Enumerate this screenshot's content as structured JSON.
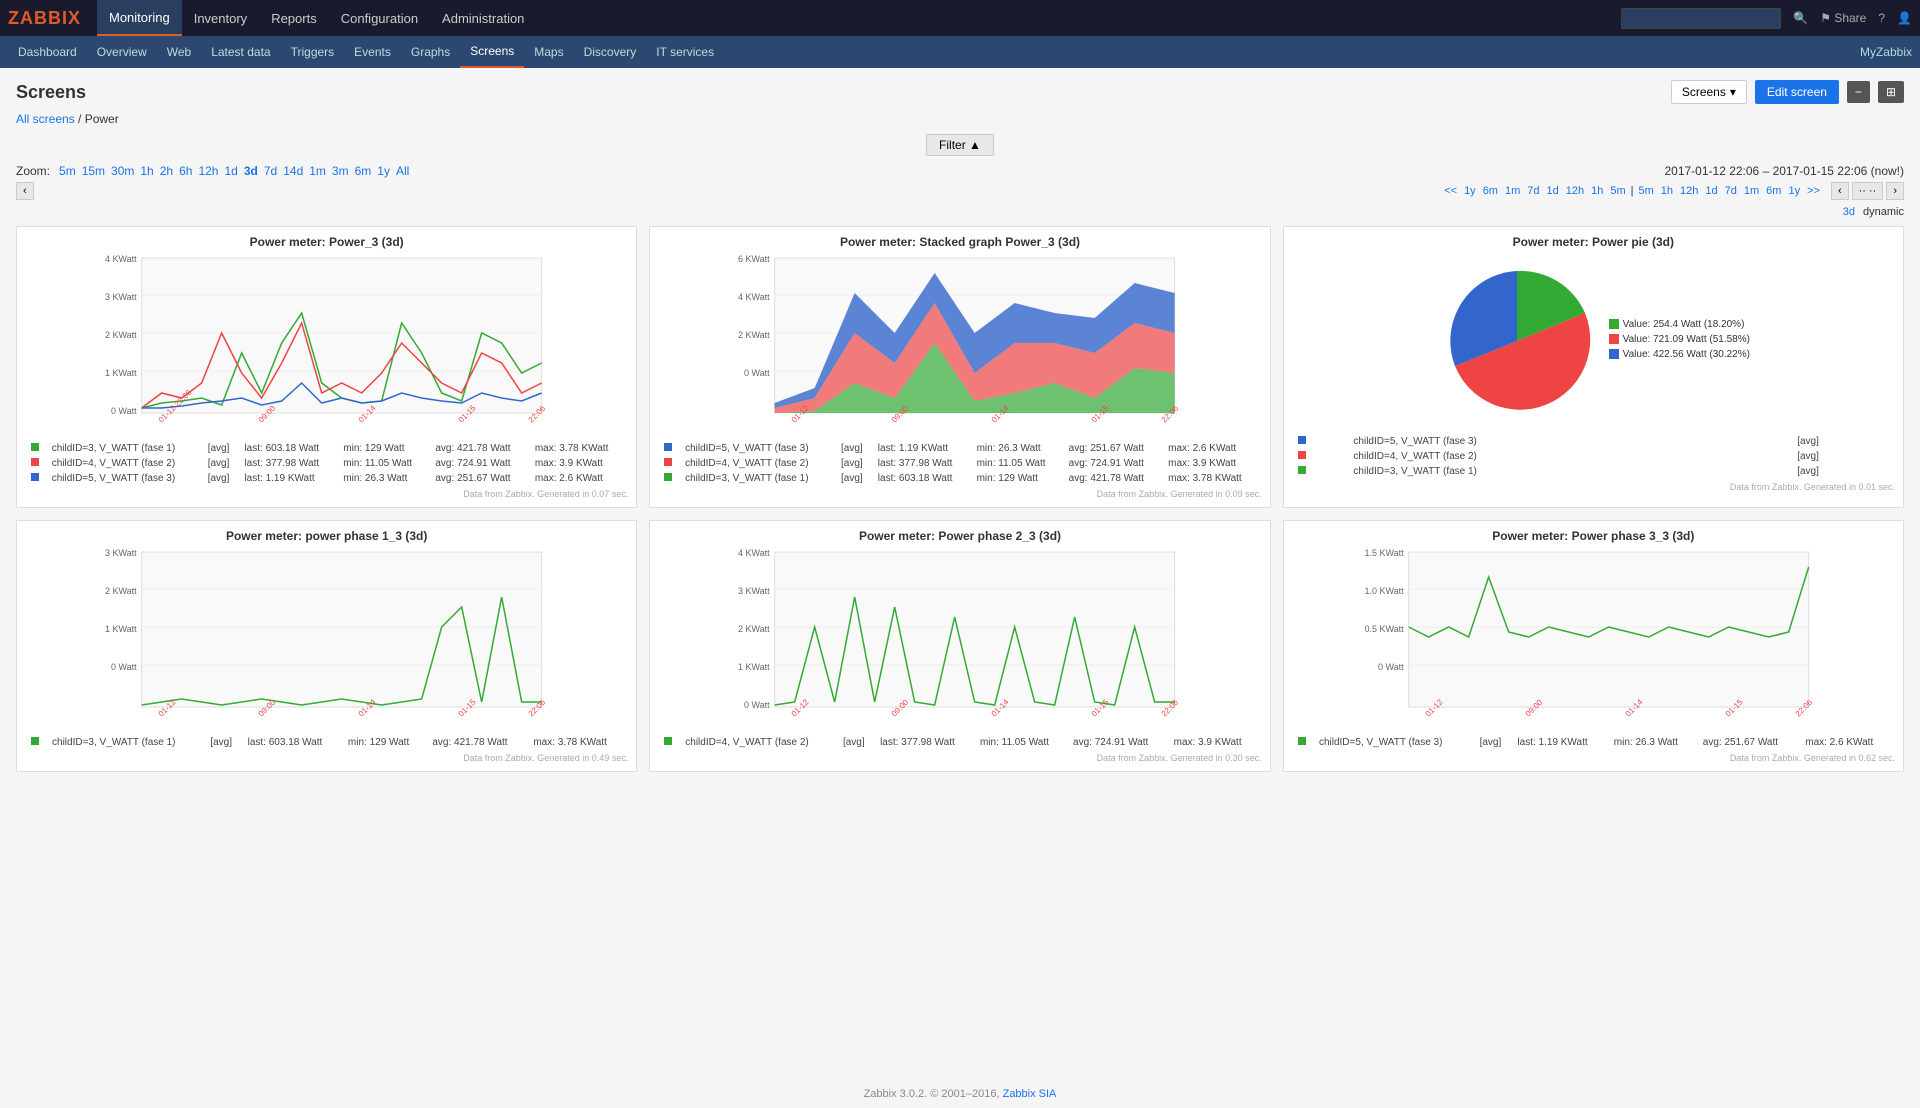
{
  "logo": "ZABBIX",
  "nav": {
    "items": [
      "Monitoring",
      "Inventory",
      "Reports",
      "Configuration",
      "Administration"
    ],
    "active": "Monitoring"
  },
  "subnav": {
    "items": [
      "Dashboard",
      "Overview",
      "Web",
      "Latest data",
      "Triggers",
      "Events",
      "Graphs",
      "Screens",
      "Maps",
      "Discovery",
      "IT services"
    ],
    "active": "Screens",
    "right": "MyZabbix"
  },
  "page": {
    "title": "Screens",
    "breadcrumb_link": "All screens",
    "breadcrumb_current": "Power",
    "dropdown_label": "Screens",
    "edit_screen": "Edit screen"
  },
  "filter": {
    "label": "Filter ▲"
  },
  "zoom": {
    "label": "Zoom:",
    "options": [
      "5m",
      "15m",
      "30m",
      "1h",
      "2h",
      "6h",
      "12h",
      "1d",
      "3d",
      "7d",
      "14d",
      "1m",
      "3m",
      "6m",
      "1y",
      "All"
    ],
    "bold": "3d",
    "date_range": "2017-01-12 22:06 – 2017-01-15 22:06 (now!)"
  },
  "time_nav": {
    "left_arrow": "‹",
    "links_left": [
      "<<",
      "1y",
      "6m",
      "1m",
      "7d",
      "1d",
      "12h",
      "1h",
      "5m"
    ],
    "separator": "|",
    "links_right": [
      "5m",
      "1h",
      "12h",
      "1d",
      "7d",
      "1m",
      "6m",
      "1y",
      ">>"
    ],
    "mode_3d": "3d",
    "mode_dynamic": "dynamic"
  },
  "charts": {
    "top": [
      {
        "id": "chart1",
        "title": "Power meter: Power_3 (3d)",
        "type": "line",
        "legend": [
          {
            "color": "#3a3",
            "label": "childID=3, V_WATT (fase 1)",
            "tag": "[avg]",
            "last": "603.18 Watt",
            "min": "129 Watt",
            "avg": "421.78 Watt",
            "max": "3.78 KWatt"
          },
          {
            "color": "#e44",
            "label": "childID=4, V_WATT (fase 2)",
            "tag": "[avg]",
            "last": "377.98 Watt",
            "min": "11.05 Watt",
            "avg": "724.91 Watt",
            "max": "3.9 KWatt"
          },
          {
            "color": "#36c",
            "label": "childID=5, V_WATT (fase 3)",
            "tag": "[avg]",
            "last": "1.19 KWatt",
            "min": "26.3 Watt",
            "avg": "251.67 Watt",
            "max": "2.6 KWatt"
          }
        ],
        "source": "Data from Zabbix. Generated in 0.07 sec."
      },
      {
        "id": "chart2",
        "title": "Power meter: Stacked graph Power_3 (3d)",
        "type": "stacked",
        "legend": [
          {
            "color": "#36c",
            "label": "childID=5, V_WATT (fase 3)",
            "tag": "[avg]",
            "last": "1.19 KWatt",
            "min": "26.3 Watt",
            "avg": "251.67 Watt",
            "max": "2.6 KWatt"
          },
          {
            "color": "#e44",
            "label": "childID=4, V_WATT (fase 2)",
            "tag": "[avg]",
            "last": "377.98 Watt",
            "min": "11.05 Watt",
            "avg": "724.91 Watt",
            "max": "3.9 KWatt"
          },
          {
            "color": "#3a3",
            "label": "childID=3, V_WATT (fase 1)",
            "tag": "[avg]",
            "last": "603.18 Watt",
            "min": "129 Watt",
            "avg": "421.78 Watt",
            "max": "3.78 KWatt"
          }
        ],
        "source": "Data from Zabbix. Generated in 0.09 sec."
      },
      {
        "id": "chart3",
        "title": "Power meter: Power pie (3d)",
        "type": "pie",
        "slices": [
          {
            "color": "#36c",
            "label": "childID=5, V_WATT (fase 3)",
            "tag": "[avg]",
            "pct": 30.22,
            "value": "422.56 Watt"
          },
          {
            "color": "#e44",
            "label": "childID=4, V_WATT (fase 2)",
            "tag": "[avg]",
            "pct": 51.58,
            "value": "721.09 Watt"
          },
          {
            "color": "#3a3",
            "label": "childID=3, V_WATT (fase 1)",
            "tag": "[avg]",
            "pct": 18.2,
            "value": "254.4 Watt"
          }
        ],
        "pie_legend": [
          {
            "color": "#3a3",
            "text": "Value: 254.4 Watt (18.20%)"
          },
          {
            "color": "#e44",
            "text": "Value: 721.09 Watt (51.58%)"
          },
          {
            "color": "#36c",
            "text": "Value: 422.56 Watt (30.22%)"
          }
        ],
        "source": "Data from Zabbix. Generated in 0.01 sec."
      }
    ],
    "bottom": [
      {
        "id": "chart4",
        "title": "Power meter: power phase 1_3 (3d)",
        "type": "line_single",
        "legend": [
          {
            "color": "#3a3",
            "label": "childID=3, V_WATT (fase 1)",
            "tag": "[avg]",
            "last": "603.18 Watt",
            "min": "129 Watt",
            "avg": "421.78 Watt",
            "max": "3.78 KWatt"
          }
        ],
        "source": "Data from Zabbix. Generated in 0.49 sec."
      },
      {
        "id": "chart5",
        "title": "Power meter: Power phase 2_3 (3d)",
        "type": "line_single",
        "legend": [
          {
            "color": "#3a3",
            "label": "childID=4, V_WATT (fase 2)",
            "tag": "[avg]",
            "last": "377.98 Watt",
            "min": "11.05 Watt",
            "avg": "724.91 Watt",
            "max": "3.9 KWatt"
          }
        ],
        "source": "Data from Zabbix. Generated in 0.30 sec."
      },
      {
        "id": "chart6",
        "title": "Power meter: Power phase 3_3 (3d)",
        "type": "line_single",
        "legend": [
          {
            "color": "#3a3",
            "label": "childID=5, V_WATT (fase 3)",
            "tag": "[avg]",
            "last": "1.19 KWatt",
            "min": "26.3 Watt",
            "avg": "251.67 Watt",
            "max": "2.6 KWatt"
          }
        ],
        "source": "Data from Zabbix. Generated in 0.62 sec."
      }
    ]
  },
  "footer": {
    "text": "Zabbix 3.0.2. © 2001–2016,",
    "link_text": "Zabbix SIA"
  }
}
